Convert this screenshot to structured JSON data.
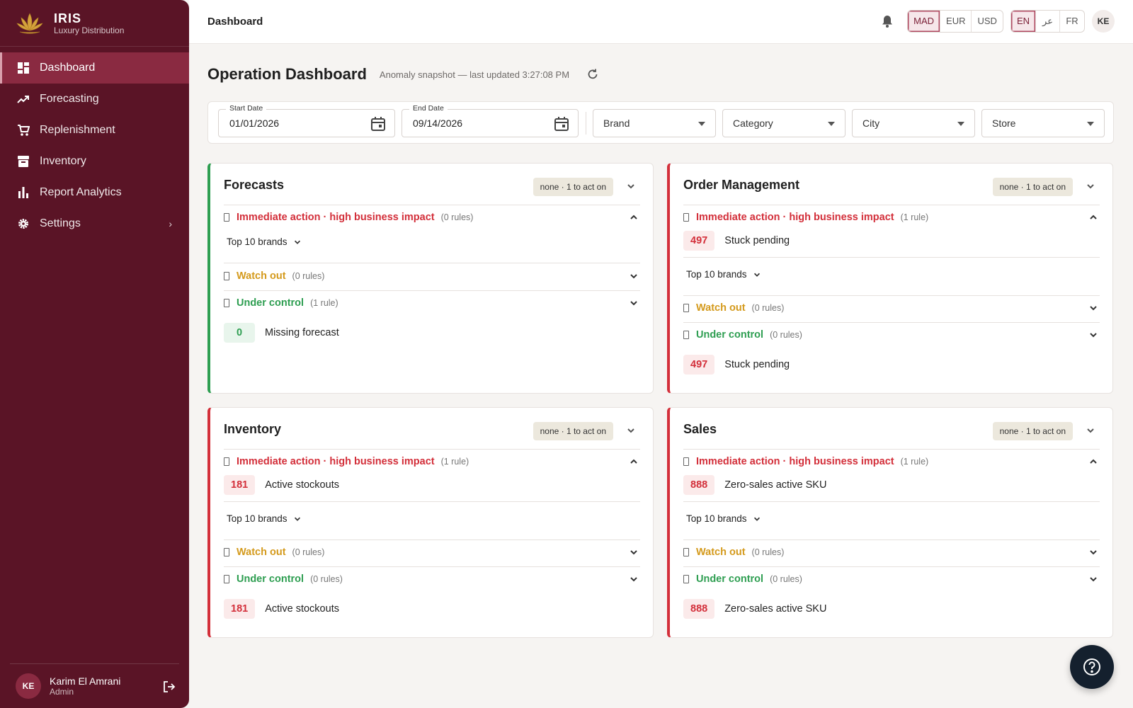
{
  "brand": {
    "name": "IRIS",
    "tagline": "Luxury Distribution"
  },
  "sidebar": {
    "items": [
      {
        "label": "Dashboard",
        "icon": "dashboard-icon",
        "active": true
      },
      {
        "label": "Forecasting",
        "icon": "trending-up-icon"
      },
      {
        "label": "Replenishment",
        "icon": "cart-icon"
      },
      {
        "label": "Inventory",
        "icon": "archive-icon"
      },
      {
        "label": "Report Analytics",
        "icon": "bar-chart-icon"
      },
      {
        "label": "Settings",
        "icon": "gear-icon"
      }
    ]
  },
  "user": {
    "initials": "KE",
    "name": "Karim El Amrani",
    "role": "Admin"
  },
  "topbar": {
    "title": "Dashboard",
    "currencies": [
      "MAD",
      "EUR",
      "USD"
    ],
    "selected_currency": "MAD",
    "languages": [
      "EN",
      "عر",
      "FR"
    ],
    "selected_language": "EN",
    "avatar_initials": "KE"
  },
  "page": {
    "title": "Operation Dashboard",
    "subtitle": "Anomaly snapshot — last updated 3:27:08 PM"
  },
  "filters": {
    "start_label": "Start Date",
    "start_value": "01/01/2026",
    "end_label": "End Date",
    "end_value": "09/14/2026",
    "brand": "Brand",
    "category": "Category",
    "city": "City",
    "store": "Store"
  },
  "cards": {
    "forecasts": {
      "title": "Forecasts",
      "badge": "none · 1 to act on",
      "immediate": {
        "title": "Immediate action · high business impact",
        "count": "(0 rules)"
      },
      "top_brands": "Top 10 brands",
      "watch": {
        "title": "Watch out",
        "count": "(0 rules)"
      },
      "under": {
        "title": "Under control",
        "count": "(1 rule)"
      },
      "under_metric": {
        "value": "0",
        "label": "Missing forecast"
      }
    },
    "orders": {
      "title": "Order Management",
      "badge": "none · 1 to act on",
      "immediate": {
        "title": "Immediate action · high business impact",
        "count": "(1 rule)"
      },
      "immediate_metric": {
        "value": "497",
        "label": "Stuck pending"
      },
      "top_brands": "Top 10 brands",
      "watch": {
        "title": "Watch out",
        "count": "(0 rules)"
      },
      "under": {
        "title": "Under control",
        "count": "(0 rules)"
      },
      "under_metric": {
        "value": "497",
        "label": "Stuck pending"
      }
    },
    "inventory": {
      "title": "Inventory",
      "badge": "none · 1 to act on",
      "immediate": {
        "title": "Immediate action · high business impact",
        "count": "(1 rule)"
      },
      "immediate_metric": {
        "value": "181",
        "label": "Active stockouts"
      },
      "top_brands": "Top 10 brands",
      "watch": {
        "title": "Watch out",
        "count": "(0 rules)"
      },
      "under": {
        "title": "Under control",
        "count": "(0 rules)"
      },
      "under_metric": {
        "value": "181",
        "label": "Active stockouts"
      }
    },
    "sales": {
      "title": "Sales",
      "badge": "none · 1 to act on",
      "immediate": {
        "title": "Immediate action · high business impact",
        "count": "(1 rule)"
      },
      "immediate_metric": {
        "value": "888",
        "label": "Zero-sales active SKU"
      },
      "top_brands": "Top 10 brands",
      "watch": {
        "title": "Watch out",
        "count": "(0 rules)"
      },
      "under": {
        "title": "Under control",
        "count": "(0 rules)"
      },
      "under_metric": {
        "value": "888",
        "label": "Zero-sales active SKU"
      }
    }
  },
  "colors": {
    "sidebar": "#5a1426",
    "active": "#8a2a41",
    "critical": "#d32f3a",
    "warning": "#d49a1c",
    "ok": "#2e9e51"
  }
}
